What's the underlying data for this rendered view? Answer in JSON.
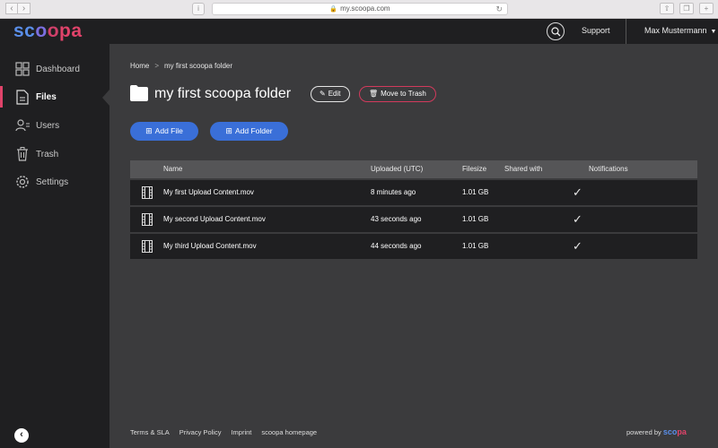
{
  "browser": {
    "url": "my.scoopa.com"
  },
  "header": {
    "logo": {
      "sc": "sc",
      "o1": "o",
      "o2": "o",
      "pa": "pa"
    },
    "support_label": "Support",
    "user_name": "Max Mustermann",
    "accent_color": "#3a6fd8",
    "brand_color": "#e0436a"
  },
  "sidebar": {
    "items": [
      {
        "label": "Dashboard",
        "icon": "grid-icon",
        "active": false
      },
      {
        "label": "Files",
        "icon": "file-icon",
        "active": true
      },
      {
        "label": "Users",
        "icon": "users-icon",
        "active": false
      },
      {
        "label": "Trash",
        "icon": "trash-icon",
        "active": false
      },
      {
        "label": "Settings",
        "icon": "gear-icon",
        "active": false
      }
    ],
    "collapse_glyph": "‹"
  },
  "breadcrumb": {
    "home": "Home",
    "separator": ">",
    "current": "my first scoopa folder"
  },
  "folder": {
    "title": "my first scoopa folder",
    "edit_label": "Edit",
    "trash_label": "Move to Trash"
  },
  "actions": {
    "add_file": "Add File",
    "add_folder": "Add Folder"
  },
  "table": {
    "headers": {
      "name": "Name",
      "uploaded": "Uploaded (UTC)",
      "filesize": "Filesize",
      "shared": "Shared with",
      "notifications": "Notifications"
    },
    "rows": [
      {
        "name": "My first Upload Content.mov",
        "uploaded": "8 minutes ago",
        "filesize": "1.01 GB",
        "shared": "",
        "notifications": "✓"
      },
      {
        "name": "My second Upload Content.mov",
        "uploaded": "43 seconds ago",
        "filesize": "1.01 GB",
        "shared": "",
        "notifications": "✓"
      },
      {
        "name": "My third Upload Content.mov",
        "uploaded": "44 seconds ago",
        "filesize": "1.01 GB",
        "shared": "",
        "notifications": "✓"
      }
    ]
  },
  "footer": {
    "links": [
      "Terms & SLA",
      "Privacy Policy",
      "Imprint",
      "scoopa homepage"
    ],
    "powered_by": "powered by",
    "powered_logo": {
      "sco": "sco",
      "pa": "pa"
    }
  }
}
